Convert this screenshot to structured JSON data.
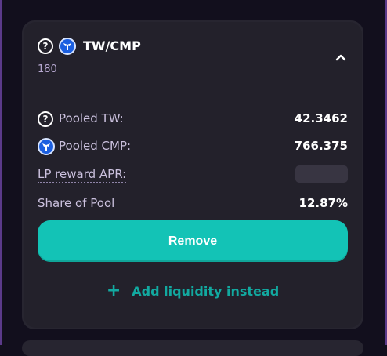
{
  "pair": {
    "title": "TW/CMP",
    "subtitle": "180"
  },
  "rows": {
    "pooled_tw": {
      "label": "Pooled TW:",
      "value": "42.3462"
    },
    "pooled_cmp": {
      "label": "Pooled CMP:",
      "value": "766.375"
    },
    "lp_apr": {
      "label": "LP reward APR:"
    },
    "share": {
      "label": "Share of Pool",
      "value": "12.87%"
    }
  },
  "actions": {
    "remove_label": "Remove",
    "add_label": "Add liquidity instead",
    "add_icon": "+"
  },
  "icons": {
    "tw": "question-circle-icon",
    "cmp": "cmp-token-icon",
    "collapse": "chevron-up-icon"
  },
  "colors": {
    "accent": "#13c3b6",
    "accent_text": "#12a9a0",
    "card": "#23212b",
    "background": "#120f1d",
    "border": "#5b3a8a"
  }
}
